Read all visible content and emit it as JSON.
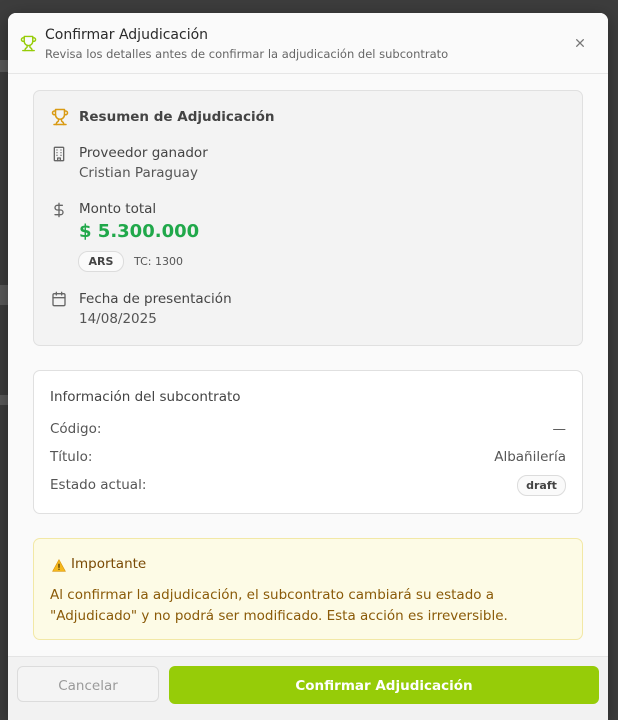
{
  "dialog": {
    "title": "Confirmar Adjudicación",
    "subtitle": "Revisa los detalles antes de confirmar la adjudicación del subcontrato"
  },
  "summary": {
    "title": "Resumen de Adjudicación",
    "provider_label": "Proveedor ganador",
    "provider_value": "Cristian Paraguay",
    "amount_label": "Monto total",
    "amount_value": "$ 5.300.000",
    "currency": "ARS",
    "exchange_rate": "TC: 1300",
    "date_label": "Fecha de presentación",
    "date_value": "14/08/2025"
  },
  "subcontract": {
    "title": "Información del subcontrato",
    "code_label": "Código:",
    "code_value": "—",
    "title_label": "Título:",
    "title_value": "Albañilería",
    "status_label": "Estado actual:",
    "status_value": "draft"
  },
  "warning": {
    "title": "Importante",
    "text": "Al confirmar la adjudicación, el subcontrato cambiará su estado a \"Adjudicado\" y no podrá ser modificado. Esta acción es irreversible."
  },
  "footer": {
    "cancel_label": "Cancelar",
    "confirm_label": "Confirmar Adjudicación"
  },
  "colors": {
    "accent_green": "#96cc08",
    "amount_green": "#20a84a",
    "trophy": "#d99a12",
    "warning_bg": "#fdfbe6",
    "warning_text": "#8a5a08"
  },
  "icons": [
    "trophy-icon",
    "close-icon",
    "building-icon",
    "dollar-icon",
    "calendar-icon",
    "warning-icon"
  ]
}
